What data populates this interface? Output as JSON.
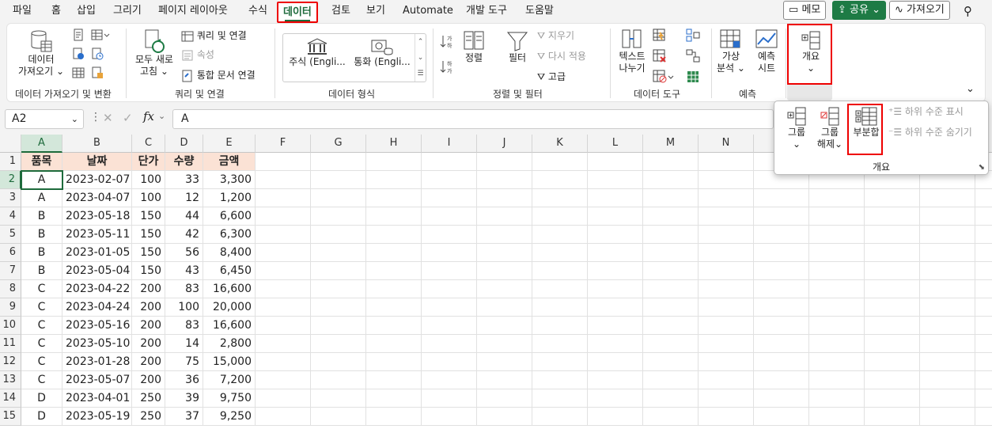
{
  "menu": {
    "tabs": [
      "파일",
      "홈",
      "삽입",
      "그리기",
      "페이지 레이아웃",
      "수식",
      "데이터",
      "검토",
      "보기",
      "Automate",
      "개발 도구",
      "도움말"
    ],
    "active_tab": "데이터"
  },
  "top_right": {
    "memo": "메모",
    "share": "공유",
    "get": "가져오기"
  },
  "ribbon": {
    "get_data": {
      "line1": "데이터",
      "line2": "가져오기",
      "group": "데이터 가져오기 및 변환"
    },
    "refresh": {
      "line1": "모두 새로",
      "line2": "고침",
      "queries": "쿼리 및 연결",
      "properties": "속성",
      "edit_links": "통합 문서 연결",
      "group": "쿼리 및 연결"
    },
    "data_types": {
      "stocks": "주식 (Engli...",
      "currency": "통화 (Engli...",
      "group": "데이터 형식"
    },
    "sort_filter": {
      "sort": "정렬",
      "filter": "필터",
      "clear": "지우기",
      "reapply": "다시 적용",
      "advanced": "고급",
      "group": "정렬 및 필터"
    },
    "data_tools": {
      "line1": "텍스트",
      "line2": "나누기",
      "group": "데이터 도구"
    },
    "forecast": {
      "whatif1": "가상",
      "whatif2": "분석",
      "sheet1": "예측",
      "sheet2": "시트",
      "group": "예측"
    },
    "outline": {
      "label": "개요"
    }
  },
  "formula_bar": {
    "name_box": "A2",
    "fx": "fx",
    "value": "A"
  },
  "popup": {
    "group": "그룹",
    "ungroup1": "그룹",
    "ungroup2": "해제",
    "subtotal": "부분합",
    "show_detail": "하위 수준 표시",
    "hide_detail": "하위 수준 숨기기",
    "label": "개요"
  },
  "sheet": {
    "columns": [
      "A",
      "B",
      "C",
      "D",
      "E",
      "F",
      "G",
      "H",
      "I",
      "J",
      "K",
      "L",
      "M",
      "N"
    ],
    "row_numbers": [
      "1",
      "2",
      "3",
      "4",
      "5",
      "6",
      "7",
      "8",
      "9",
      "10",
      "11",
      "12",
      "13",
      "14",
      "15"
    ],
    "headers": [
      "품목",
      "날짜",
      "단가",
      "수량",
      "금액"
    ],
    "rows": [
      [
        "A",
        "2023-02-07",
        "100",
        "33",
        "3,300"
      ],
      [
        "A",
        "2023-04-07",
        "100",
        "12",
        "1,200"
      ],
      [
        "B",
        "2023-05-18",
        "150",
        "44",
        "6,600"
      ],
      [
        "B",
        "2023-05-11",
        "150",
        "42",
        "6,300"
      ],
      [
        "B",
        "2023-01-05",
        "150",
        "56",
        "8,400"
      ],
      [
        "B",
        "2023-05-04",
        "150",
        "43",
        "6,450"
      ],
      [
        "C",
        "2023-04-22",
        "200",
        "83",
        "16,600"
      ],
      [
        "C",
        "2023-04-24",
        "200",
        "100",
        "20,000"
      ],
      [
        "C",
        "2023-05-16",
        "200",
        "83",
        "16,600"
      ],
      [
        "C",
        "2023-05-10",
        "200",
        "14",
        "2,800"
      ],
      [
        "C",
        "2023-01-28",
        "200",
        "75",
        "15,000"
      ],
      [
        "C",
        "2023-05-07",
        "200",
        "36",
        "7,200"
      ],
      [
        "D",
        "2023-04-01",
        "250",
        "39",
        "9,750"
      ],
      [
        "D",
        "2023-05-19",
        "250",
        "37",
        "9,250"
      ]
    ]
  },
  "colors": {
    "accent": "#1e6b3c",
    "highlight": "#e00000",
    "header_fill": "#fbe2d5"
  }
}
